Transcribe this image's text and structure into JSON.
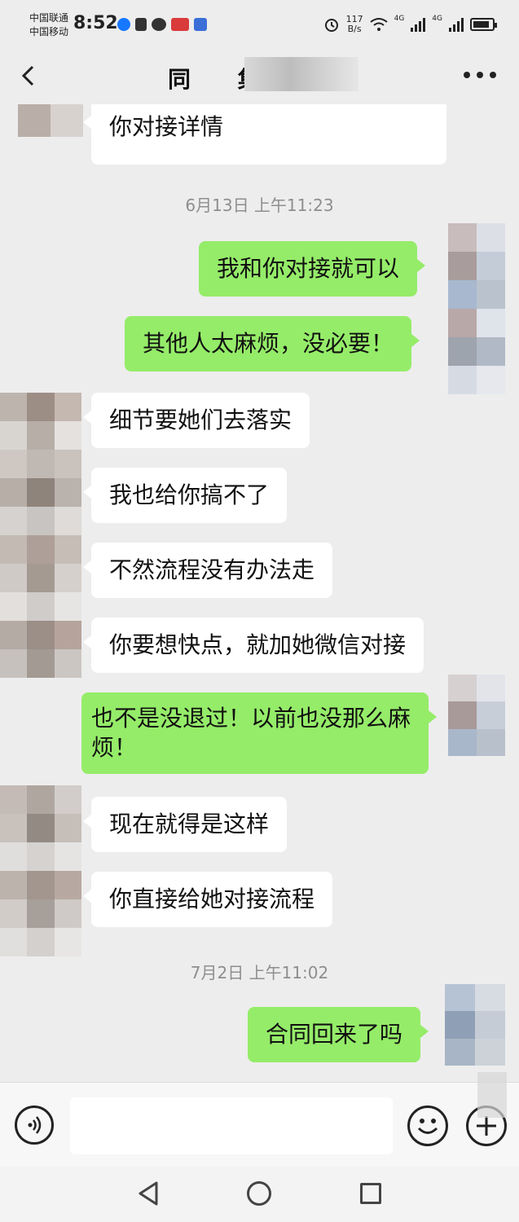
{
  "status_bar": {
    "carrier_1": "中国联通",
    "carrier_2": "中国移动",
    "time": "8:52",
    "net_speed_value": "117",
    "net_speed_unit": "B/s",
    "signal_1_label": "4G",
    "signal_2_label": "4G",
    "battery_level": 0.85
  },
  "header": {
    "title": "同 集"
  },
  "messages": [
    {
      "direction": "in",
      "text": "你对接详情"
    },
    {
      "direction": "timestamp",
      "text": "6月13日 上午11:23"
    },
    {
      "direction": "out",
      "text": "我和你对接就可以"
    },
    {
      "direction": "out",
      "text": "其他人太麻烦，没必要！"
    },
    {
      "direction": "in",
      "text": "细节要她们去落实"
    },
    {
      "direction": "in",
      "text": "我也给你搞不了"
    },
    {
      "direction": "in",
      "text": "不然流程没有办法走"
    },
    {
      "direction": "in",
      "text": "你要想快点，就加她微信对接"
    },
    {
      "direction": "out",
      "text": "也不是没退过！以前也没那么麻烦！"
    },
    {
      "direction": "in",
      "text": "现在就得是这样"
    },
    {
      "direction": "in",
      "text": "你直接给她对接流程"
    },
    {
      "direction": "timestamp",
      "text": "7月2日 上午11:02"
    },
    {
      "direction": "out",
      "text": "合同回来了吗"
    }
  ],
  "colors": {
    "background": "#ededed",
    "bubble_out": "#95ec69",
    "bubble_in": "#ffffff"
  }
}
